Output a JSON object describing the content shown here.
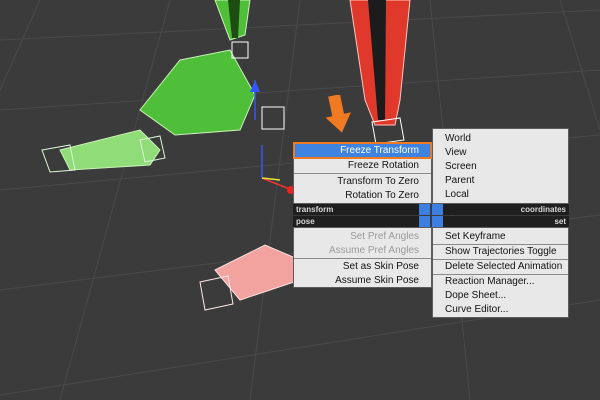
{
  "colors": {
    "viewport_bg": "#3b3b3b",
    "grid": "#4a4a4a",
    "green_model": "#4fbf3a",
    "red_model": "#e0382a",
    "pink_model": "#f2a3a0",
    "menu_bg": "#e8e8e8",
    "menu_highlight": "#3f83e0",
    "accent_orange": "#ef7a21",
    "quad_label_bar": "#1f1f1f"
  },
  "icons": {
    "annotation_arrow": "orange-down-arrow-icon",
    "gizmo": "transform-gizmo-icon"
  },
  "quad_menu": {
    "left_top": {
      "items": [
        {
          "label": "Freeze Transform",
          "highlighted": true
        },
        {
          "label": "Freeze Rotation"
        },
        {
          "label": "Transform To Zero"
        },
        {
          "label": "Rotation To Zero"
        }
      ],
      "bar_label": "transform"
    },
    "right_top": {
      "items": [
        {
          "label": "World"
        },
        {
          "label": "View"
        },
        {
          "label": "Screen"
        },
        {
          "label": "Parent"
        },
        {
          "label": "Local"
        }
      ],
      "bar_label": "coordinates"
    },
    "left_bottom": {
      "bar_label": "pose",
      "items": [
        {
          "label": "Set Pref Angles",
          "disabled": true
        },
        {
          "label": "Assume Pref Angles",
          "disabled": true
        },
        {
          "label": "Set as Skin Pose"
        },
        {
          "label": "Assume Skin Pose"
        }
      ]
    },
    "right_bottom": {
      "bar_label": "set",
      "items": [
        {
          "label": "Set Keyframe"
        },
        {
          "label": "Show Trajectories Toggle"
        },
        {
          "label": "Delete Selected Animation"
        },
        {
          "label": "Reaction Manager..."
        },
        {
          "label": "Dope Sheet..."
        },
        {
          "label": "Curve Editor..."
        }
      ]
    }
  }
}
